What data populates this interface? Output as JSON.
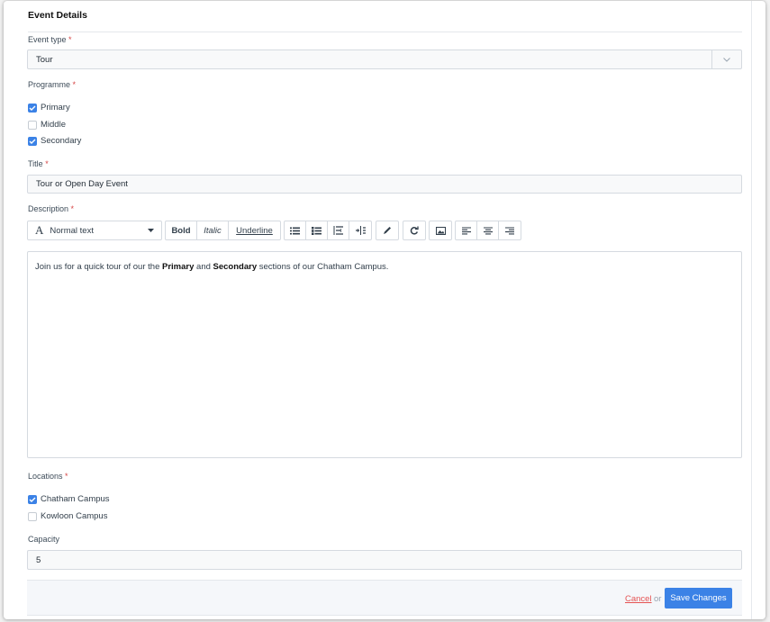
{
  "section": {
    "title": "Event Details"
  },
  "required_mark": "*",
  "event_type": {
    "label": "Event type",
    "value": "Tour"
  },
  "programme": {
    "label": "Programme",
    "options": [
      {
        "label": "Primary",
        "checked": true
      },
      {
        "label": "Middle",
        "checked": false
      },
      {
        "label": "Secondary",
        "checked": true
      }
    ]
  },
  "title_field": {
    "label": "Title",
    "value": "Tour or Open Day Event"
  },
  "description": {
    "label": "Description",
    "toolbar": {
      "block_style": "Normal text",
      "bold": "Bold",
      "italic": "Italic",
      "underline": "Underline",
      "icons": [
        "bullet-list-icon",
        "numbered-list-icon",
        "outdent-icon",
        "indent-icon",
        "pen-icon",
        "redo-icon",
        "image-icon",
        "align-left-icon",
        "align-center-icon",
        "align-right-icon"
      ]
    },
    "content": {
      "part1": "Join us for a quick tour of our the ",
      "bold1": "Primary",
      "part2": " and ",
      "bold2": "Secondary",
      "part3": " sections of our Chatham Campus."
    }
  },
  "locations": {
    "label": "Locations",
    "options": [
      {
        "label": "Chatham Campus",
        "checked": true
      },
      {
        "label": "Kowloon Campus",
        "checked": false
      }
    ]
  },
  "capacity": {
    "label": "Capacity",
    "value": "5"
  },
  "footer": {
    "cancel": "Cancel",
    "or": "or",
    "save": "Save Changes"
  },
  "colors": {
    "accent": "#3b82e6",
    "required": "#d64545",
    "cancel": "#e55353"
  }
}
